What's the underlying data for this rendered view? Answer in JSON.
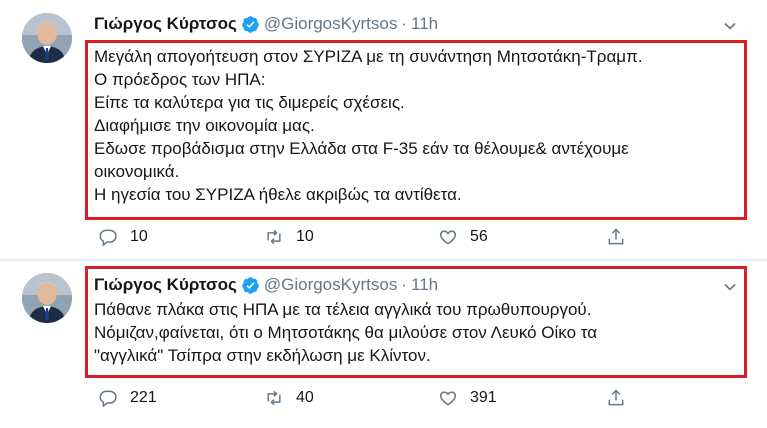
{
  "colors": {
    "highlight_box": "#d81f26",
    "verified": "#1da1f2",
    "muted": "#657786"
  },
  "tweets": [
    {
      "author_name": "Γιώργος Κύρτσος",
      "handle": "@GiorgosKyrtsos",
      "separator": "·",
      "time": "11h",
      "lines": [
        "Μεγάλη απογοήτευση στον ΣΥΡΙΖΑ με τη συνάντηση Μητσοτάκη-Τραμπ.",
        "Ο πρόεδρος των ΗΠΑ:",
        "Είπε τα καλύτερα για τις διμερείς σχέσεις.",
        "Διαφήμισε την οικονομία μας.",
        "Εδωσε προβάδισμα στην Ελλάδα στα F-35 εάν τα θέλουμε& αντέχουμε",
        "οικονομικά.",
        "Η ηγεσία του ΣΥΡΙΖΑ ήθελε ακριβώς τα αντίθετα."
      ],
      "replies": "10",
      "retweets": "10",
      "likes": "56",
      "icons": [
        "reply-icon",
        "retweet-icon",
        "like-icon",
        "share-icon"
      ]
    },
    {
      "author_name": "Γιώργος Κύρτσος",
      "handle": "@GiorgosKyrtsos",
      "separator": "·",
      "time": "11h",
      "lines": [
        "Πάθανε πλάκα στις ΗΠΑ με τα τέλεια αγγλικά του πρωθυπουργού.",
        "Νόμιζαν,φαίνεται, ότι ο Μητσοτάκης θα μιλούσε στον Λευκό Οίκο τα",
        "\"αγγλικά\" Τσίπρα στην εκδήλωση με Κλίντον."
      ],
      "replies": "221",
      "retweets": "40",
      "likes": "391",
      "icons": [
        "reply-icon",
        "retweet-icon",
        "like-icon",
        "share-icon"
      ]
    }
  ]
}
